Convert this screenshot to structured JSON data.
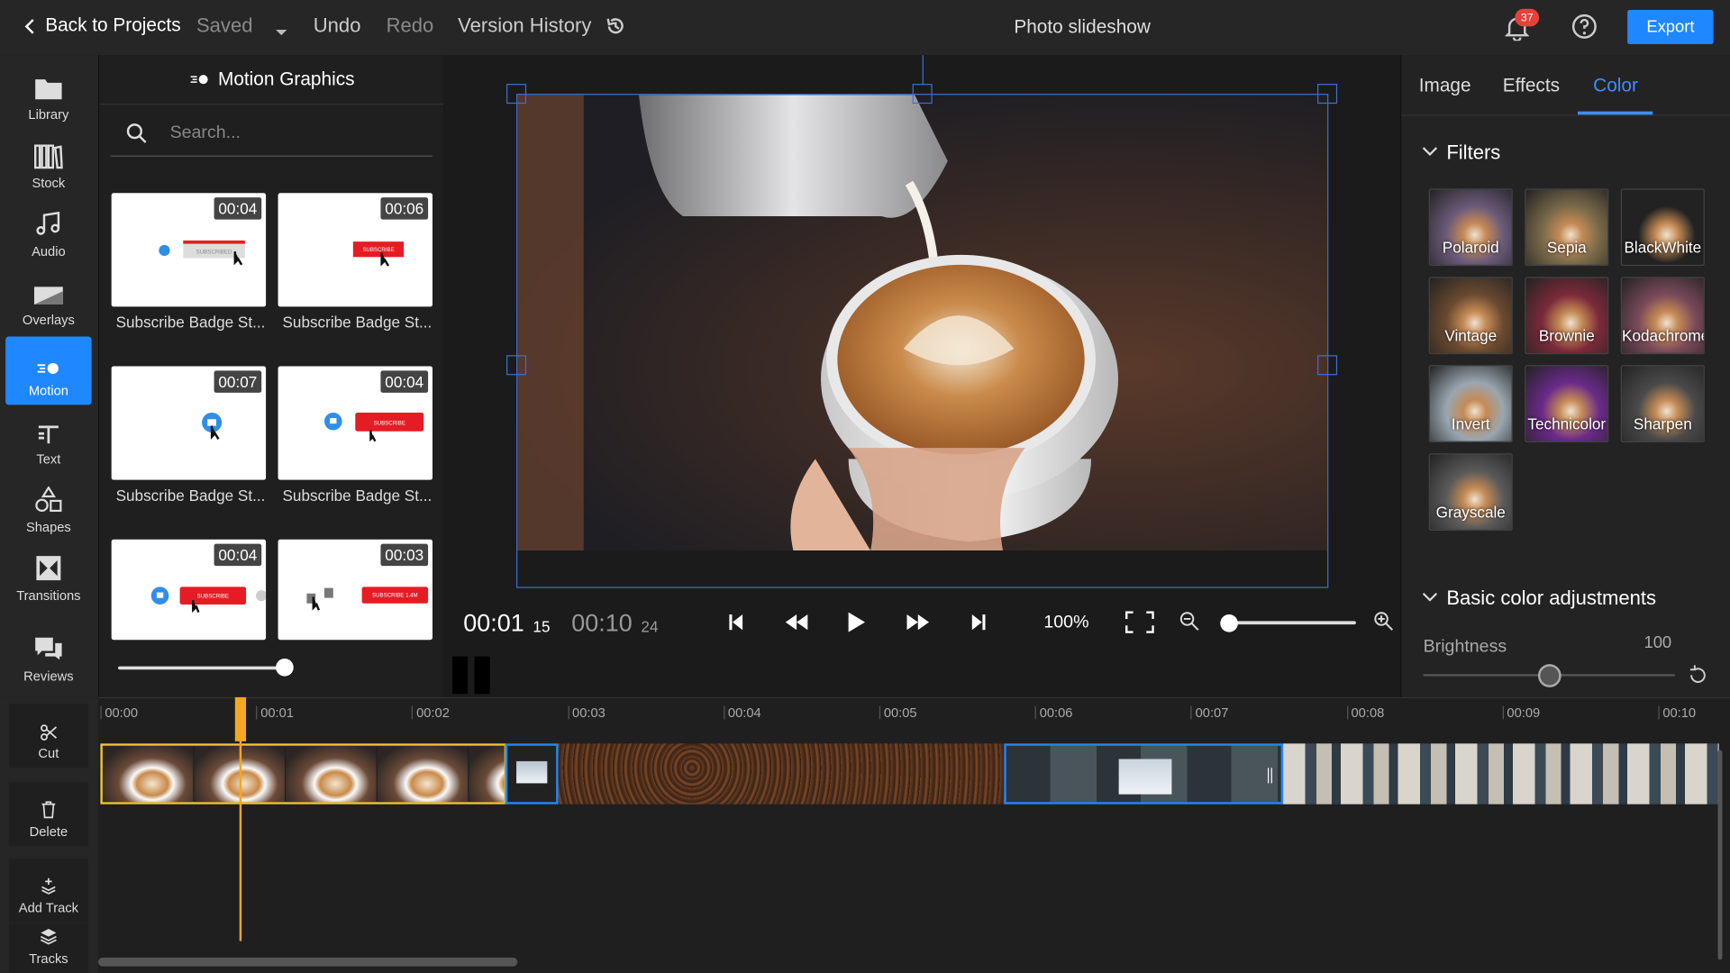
{
  "topbar": {
    "back_label": "Back to Projects",
    "saved_label": "Saved",
    "undo_label": "Undo",
    "redo_label": "Redo",
    "version_history_label": "Version History",
    "project_title": "Photo slideshow",
    "notification_count": "37",
    "export_label": "Export"
  },
  "rail": {
    "items": [
      {
        "label": "Library",
        "icon": "folder-icon"
      },
      {
        "label": "Stock",
        "icon": "stock-icon"
      },
      {
        "label": "Audio",
        "icon": "music-icon"
      },
      {
        "label": "Overlays",
        "icon": "overlay-icon"
      },
      {
        "label": "Motion",
        "icon": "motion-icon"
      },
      {
        "label": "Text",
        "icon": "text-icon"
      },
      {
        "label": "Shapes",
        "icon": "shapes-icon"
      },
      {
        "label": "Transitions",
        "icon": "transitions-icon"
      },
      {
        "label": "Reviews",
        "icon": "reviews-icon"
      }
    ],
    "active": "Motion"
  },
  "panel": {
    "title": "Motion Graphics",
    "search_placeholder": "Search...",
    "items": [
      {
        "label": "Subscribe Badge St...",
        "duration": "00:04",
        "variant": "subscribed-gray"
      },
      {
        "label": "Subscribe Badge St...",
        "duration": "00:06",
        "variant": "red-small"
      },
      {
        "label": "Subscribe Badge St...",
        "duration": "00:07",
        "variant": "blue-like"
      },
      {
        "label": "Subscribe Badge St...",
        "duration": "00:04",
        "variant": "like-subscribe"
      },
      {
        "label": "",
        "duration": "00:04",
        "variant": "like-subscribe-bell"
      },
      {
        "label": "",
        "duration": "00:03",
        "variant": "thumbs-subscribe-count"
      }
    ],
    "thumb_texts": {
      "subscribed": "SUBSCRIBED",
      "subscribe": "SUBSCRIBE",
      "subscribe_count": "SUBSCRIBE 1.4M"
    },
    "size_slider_fraction": 0.4
  },
  "preview": {
    "current_time": "00:01",
    "current_frame": "15",
    "total_time": "00:10",
    "total_frame": "24",
    "zoom": "100%",
    "zoom_slider_fraction": 0.0
  },
  "right_panel": {
    "tabs": [
      "Image",
      "Effects",
      "Color"
    ],
    "active_tab": "Color",
    "filters_title": "Filters",
    "filters": [
      {
        "label": "Polaroid",
        "color": "#6b5a7a"
      },
      {
        "label": "Sepia",
        "color": "#7a6a4a"
      },
      {
        "label": "BlackWhite",
        "color": "#222222"
      },
      {
        "label": "Vintage",
        "color": "#6a4a30"
      },
      {
        "label": "Brownie",
        "color": "#7a2a3a"
      },
      {
        "label": "Kodachrome",
        "color": "#7a4a5a"
      },
      {
        "label": "Invert",
        "color": "#9aa6b0"
      },
      {
        "label": "Technicolor",
        "color": "#6a2a8a"
      },
      {
        "label": "Sharpen",
        "color": "#4a4a4a"
      },
      {
        "label": "Grayscale",
        "color": "#5a5a5a"
      }
    ],
    "basic_title": "Basic color adjustments",
    "brightness_label": "Brightness",
    "brightness_value": "100",
    "brightness_fraction": 0.5
  },
  "timeline": {
    "tools": [
      {
        "label": "Cut",
        "icon": "scissors-icon"
      },
      {
        "label": "Delete",
        "icon": "trash-icon"
      },
      {
        "label": "Add Track",
        "icon": "add-track-icon"
      },
      {
        "label": "Tracks",
        "icon": "layers-icon"
      }
    ],
    "ticks": [
      "00:00",
      "00:01",
      "00:02",
      "00:03",
      "00:04",
      "00:05",
      "00:06",
      "00:07",
      "00:08",
      "00:09",
      "00:10"
    ],
    "playhead_seconds": 1.5,
    "colors": {
      "accent": "#1f87ff",
      "playhead": "#f5a623",
      "selected_clip": "#f2c531"
    }
  }
}
